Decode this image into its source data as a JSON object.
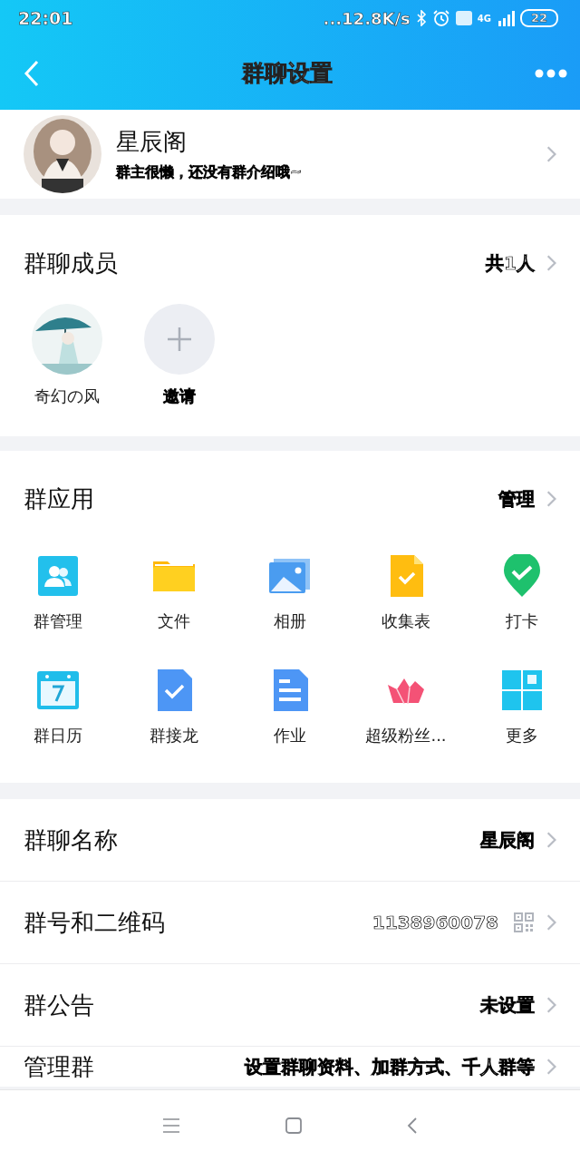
{
  "status_bar": {
    "time": "22:01",
    "dots": "...",
    "speed": "12.8K/s",
    "network": "4G",
    "battery": "22"
  },
  "header": {
    "title": "群聊设置"
  },
  "group": {
    "name": "星辰阁",
    "intro": "群主很懒，还没有群介绍哦~"
  },
  "members": {
    "title": "群聊成员",
    "count": "共1人",
    "items": [
      {
        "kind": "member",
        "name": "奇幻の风"
      },
      {
        "kind": "invite",
        "name": "邀请"
      }
    ]
  },
  "apps": {
    "title": "群应用",
    "action": "管理",
    "items": [
      {
        "kind": "manage",
        "label": "群管理"
      },
      {
        "kind": "folder",
        "label": "文件"
      },
      {
        "kind": "album",
        "label": "相册"
      },
      {
        "kind": "form",
        "label": "收集表"
      },
      {
        "kind": "checkin",
        "label": "打卡"
      },
      {
        "kind": "calendar",
        "label": "群日历"
      },
      {
        "kind": "relay",
        "label": "群接龙"
      },
      {
        "kind": "homework",
        "label": "作业"
      },
      {
        "kind": "crown",
        "label": "超级粉丝..."
      },
      {
        "kind": "more",
        "label": "更多"
      }
    ]
  },
  "settings": [
    {
      "kind": "text",
      "label": "群聊名称",
      "value": "星辰阁"
    },
    {
      "kind": "qr",
      "label": "群号和二维码",
      "value": "1138960078"
    },
    {
      "kind": "text",
      "label": "群公告",
      "value": "未设置"
    },
    {
      "kind": "text",
      "label": "管理群",
      "value": "设置群聊资料、加群方式、千人群等"
    }
  ]
}
